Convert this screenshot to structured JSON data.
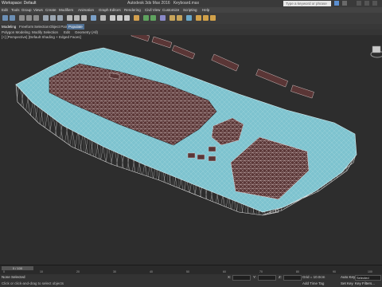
{
  "titlebar": {
    "workspace": "Workspace: Default",
    "app_title": "Autodesk 3ds Max 2016",
    "file_name": "Keyboard.max",
    "search_placeholder": "Type a keyword or phrase"
  },
  "menubar": {
    "items": [
      "Edit",
      "Tools",
      "Group",
      "Views",
      "Create",
      "Modifiers",
      "Animation",
      "Graph Editors",
      "Rendering",
      "Civil View",
      "Customize",
      "Scripting",
      "Help"
    ]
  },
  "ribbon": {
    "tabs": [
      "Modeling",
      "Freeform",
      "Selection",
      "Object Paint",
      "Populate"
    ],
    "subtabs": [
      "Polygon Modeling",
      "Modify Selection",
      "Edit",
      "Geometry (All)"
    ]
  },
  "viewport": {
    "label": "[+] [Perspective] [Default Shading + Edged Faces]"
  },
  "timeline": {
    "frame_counter": "0 / 100",
    "ticks": [
      "0",
      "10",
      "20",
      "30",
      "40",
      "50",
      "60",
      "70",
      "80",
      "90",
      "100"
    ]
  },
  "status": {
    "selection": "None Selected",
    "prompt": "Click or click-and-drag to select objects",
    "x_label": "X:",
    "y_label": "Y:",
    "z_label": "Z:",
    "grid": "Grid = 10.0cm",
    "add_time_tag": "Add Time Tag",
    "auto_key": "Auto Key",
    "auto_key_value": "Selected",
    "set_key": "Set Key",
    "key_filters": "Key Filters..."
  },
  "colors": {
    "keyboard_body": "#7ec3cf",
    "keys": "#5a3636",
    "wire": "#d0d0d0",
    "background": "#2d2d2d"
  }
}
